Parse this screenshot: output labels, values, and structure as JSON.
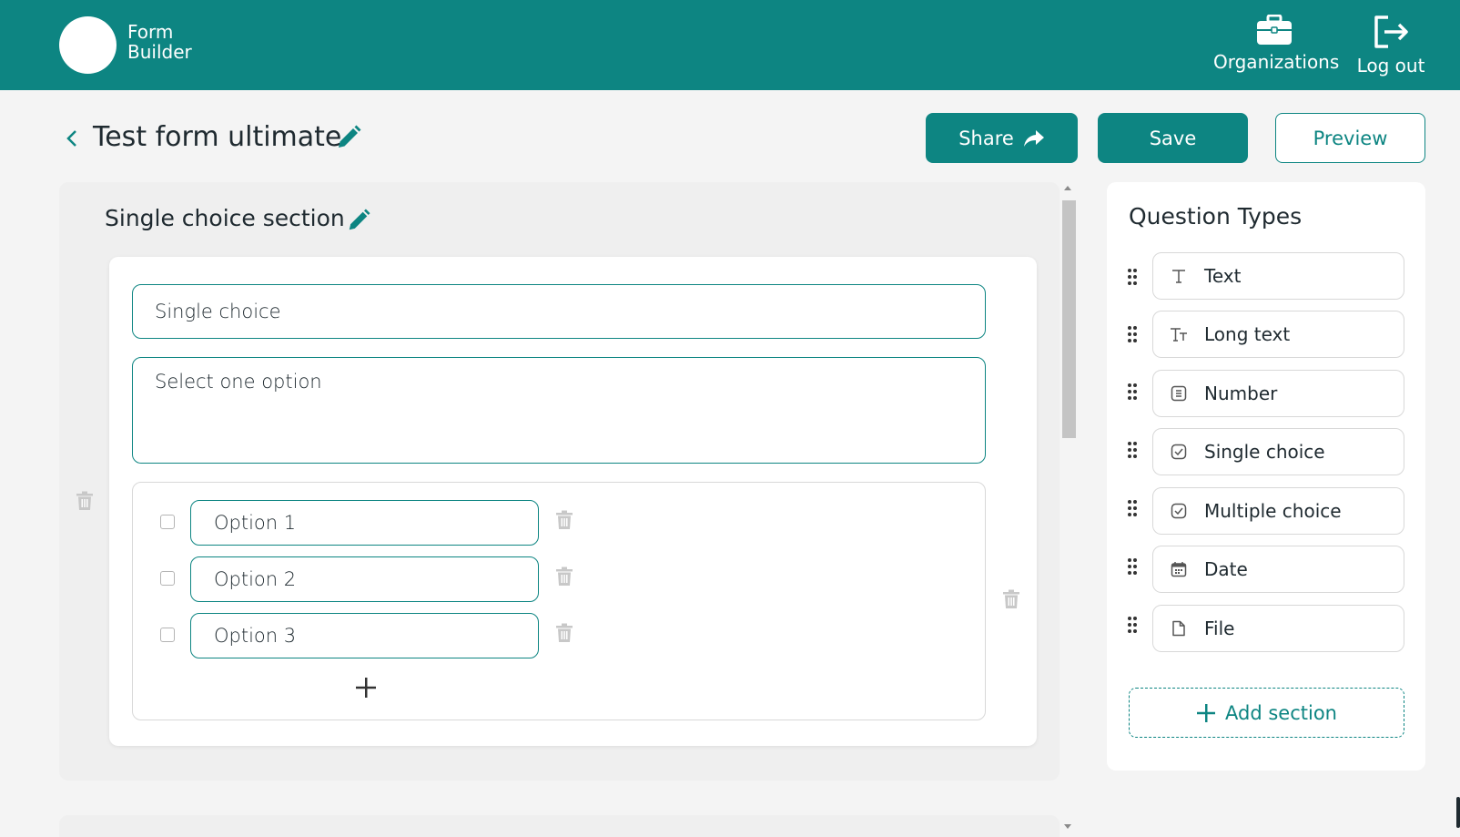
{
  "header": {
    "logo_line1": "Form",
    "logo_line2": "Builder",
    "organizations_label": "Organizations",
    "logout_label": "Log out"
  },
  "toolbar": {
    "form_title": "Test form ultimate",
    "share_label": "Share",
    "save_label": "Save",
    "preview_label": "Preview"
  },
  "section": {
    "title": "Single choice section",
    "question": {
      "title": "Single choice",
      "description": "Select one option",
      "options": [
        {
          "label": "Option 1"
        },
        {
          "label": "Option 2"
        },
        {
          "label": "Option 3"
        }
      ]
    }
  },
  "question_types": {
    "title": "Question Types",
    "items": [
      {
        "label": "Text",
        "icon": "text-icon"
      },
      {
        "label": "Long text",
        "icon": "long-text-icon"
      },
      {
        "label": "Number",
        "icon": "number-icon"
      },
      {
        "label": "Single choice",
        "icon": "checkbox-icon"
      },
      {
        "label": "Multiple choice",
        "icon": "checkbox-icon"
      },
      {
        "label": "Date",
        "icon": "calendar-icon"
      },
      {
        "label": "File",
        "icon": "file-icon"
      }
    ],
    "add_section_label": "Add section"
  },
  "colors": {
    "brand": "#0d8582",
    "background": "#f4f4f4"
  }
}
